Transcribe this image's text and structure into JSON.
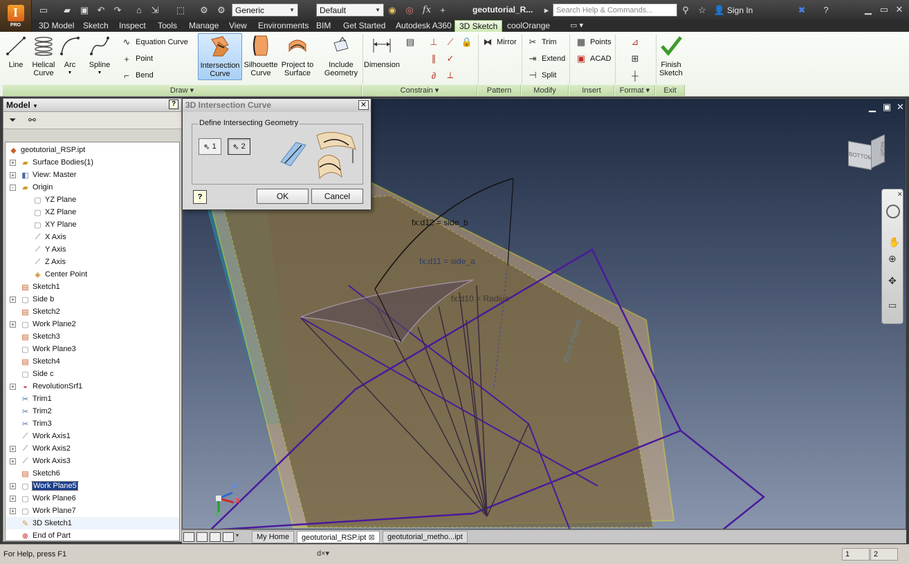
{
  "app": {
    "badge": "PRO",
    "title": "geotutorial_R...",
    "search_placeholder": "Search Help & Commands...",
    "sign_in": "Sign In",
    "material": "Generic",
    "appearance": "Default"
  },
  "ribbon_tabs": [
    "3D Model",
    "Sketch",
    "Inspect",
    "Tools",
    "Manage",
    "View",
    "Environments",
    "BIM",
    "Get Started",
    "Autodesk A360",
    "3D Sketch",
    "coolOrange"
  ],
  "ribbon": {
    "draw": {
      "label": "Draw",
      "line": "Line",
      "helical": "Helical\nCurve",
      "arc": "Arc",
      "spline": "Spline",
      "equation_curve": "Equation Curve",
      "point": "Point",
      "bend": "Bend",
      "intersection": "Intersection\nCurve",
      "silhouette": "Silhouette\nCurve",
      "project": "Project to\nSurface",
      "include": "Include\nGeometry"
    },
    "constrain": {
      "label": "Constrain",
      "dimension": "Dimension"
    },
    "pattern": {
      "label": "Pattern",
      "mirror": "Mirror"
    },
    "modify": {
      "label": "Modify",
      "trim": "Trim",
      "extend": "Extend",
      "split": "Split"
    },
    "insert": {
      "label": "Insert",
      "points": "Points",
      "acad": "ACAD"
    },
    "format": {
      "label": "Format"
    },
    "exit": {
      "label": "Exit",
      "finish": "Finish\nSketch"
    }
  },
  "browser": {
    "title": "Model",
    "items": [
      {
        "label": "geotutorial_RSP.ipt",
        "icon": "part-icon",
        "level": 0,
        "expand": ""
      },
      {
        "label": "Surface Bodies(1)",
        "icon": "folder-icon",
        "level": 1,
        "expand": "+"
      },
      {
        "label": "View: Master",
        "icon": "view-icon",
        "level": 1,
        "expand": "+"
      },
      {
        "label": "Origin",
        "icon": "folder-icon",
        "level": 1,
        "expand": "-"
      },
      {
        "label": "YZ Plane",
        "icon": "plane-icon",
        "level": 2,
        "expand": ""
      },
      {
        "label": "XZ Plane",
        "icon": "plane-icon",
        "level": 2,
        "expand": ""
      },
      {
        "label": "XY Plane",
        "icon": "plane-icon",
        "level": 2,
        "expand": ""
      },
      {
        "label": "X Axis",
        "icon": "axis-icon",
        "level": 2,
        "expand": ""
      },
      {
        "label": "Y Axis",
        "icon": "axis-icon",
        "level": 2,
        "expand": ""
      },
      {
        "label": "Z Axis",
        "icon": "axis-icon",
        "level": 2,
        "expand": ""
      },
      {
        "label": "Center Point",
        "icon": "point-icon",
        "level": 2,
        "expand": ""
      },
      {
        "label": "Sketch1",
        "icon": "sketch-icon",
        "level": 1,
        "expand": ""
      },
      {
        "label": "Side b",
        "icon": "plane-icon",
        "level": 1,
        "expand": "+"
      },
      {
        "label": "Sketch2",
        "icon": "sketch-icon",
        "level": 1,
        "expand": ""
      },
      {
        "label": "Work Plane2",
        "icon": "plane-icon",
        "level": 1,
        "expand": "+"
      },
      {
        "label": "Sketch3",
        "icon": "sketch-icon",
        "level": 1,
        "expand": ""
      },
      {
        "label": "Work Plane3",
        "icon": "plane-icon",
        "level": 1,
        "expand": ""
      },
      {
        "label": "Sketch4",
        "icon": "sketch-icon",
        "level": 1,
        "expand": ""
      },
      {
        "label": "Side c",
        "icon": "plane-icon",
        "level": 1,
        "expand": ""
      },
      {
        "label": "RevolutionSrf1",
        "icon": "revolve-icon",
        "level": 1,
        "expand": "+"
      },
      {
        "label": "Trim1",
        "icon": "trim-icon",
        "level": 1,
        "expand": ""
      },
      {
        "label": "Trim2",
        "icon": "trim-icon",
        "level": 1,
        "expand": ""
      },
      {
        "label": "Trim3",
        "icon": "trim-icon",
        "level": 1,
        "expand": ""
      },
      {
        "label": "Work Axis1",
        "icon": "axis-icon",
        "level": 1,
        "expand": ""
      },
      {
        "label": "Work Axis2",
        "icon": "axis-icon",
        "level": 1,
        "expand": "+"
      },
      {
        "label": "Work Axis3",
        "icon": "axis-icon",
        "level": 1,
        "expand": "+"
      },
      {
        "label": "Sketch6",
        "icon": "sketch-icon",
        "level": 1,
        "expand": ""
      },
      {
        "label": "Work Plane5",
        "icon": "plane-icon",
        "level": 1,
        "expand": "+",
        "selected": true
      },
      {
        "label": "Work Plane6",
        "icon": "plane-icon",
        "level": 1,
        "expand": "+"
      },
      {
        "label": "Work Plane7",
        "icon": "plane-icon",
        "level": 1,
        "expand": "+"
      },
      {
        "label": "3D Sketch1",
        "icon": "sketch3d-icon",
        "level": 1,
        "expand": "",
        "current": true
      },
      {
        "label": "End of Part",
        "icon": "end-icon",
        "level": 1,
        "expand": ""
      }
    ]
  },
  "dialog": {
    "title": "3D Intersection Curve",
    "group_title": "Define Intersecting Geometry",
    "sel1": "1",
    "sel2": "2",
    "ok": "OK",
    "cancel": "Cancel",
    "help": "?"
  },
  "viewport": {
    "dim_labels": [
      "fx:d12 = side_b",
      "fx:d11 = side_a",
      "fx:d10 = Radius"
    ],
    "watermark": "Work Plane5",
    "viewcube_face": "BOTTOM",
    "viewcube_side": "RIGHT"
  },
  "doc_tabs": [
    "My Home",
    "geotutorial_RSP.ipt",
    "geotutorial_metho...ipt"
  ],
  "status": {
    "help": "For Help, press F1",
    "count1": "1",
    "count2": "2"
  }
}
